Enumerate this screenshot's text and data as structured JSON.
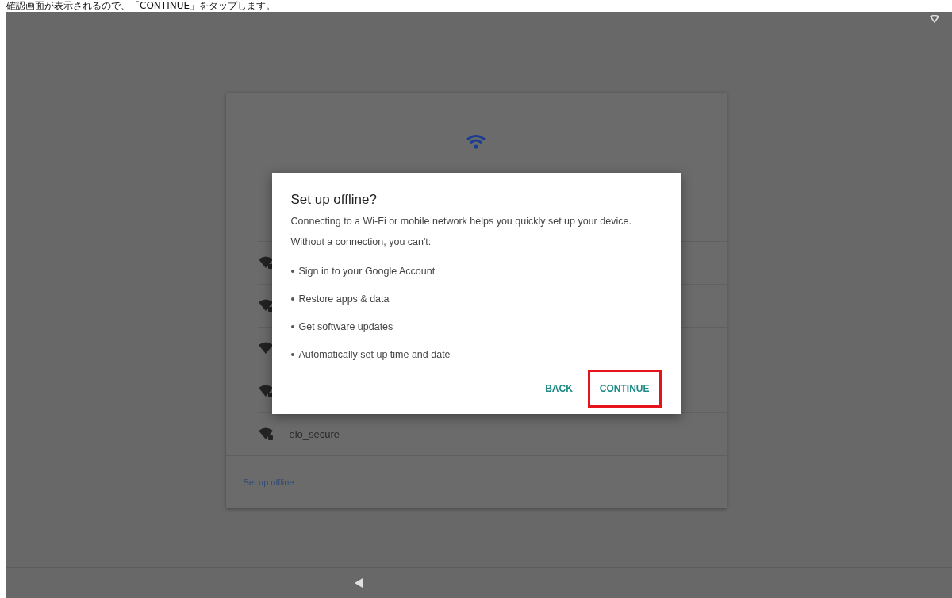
{
  "caption": "確認画面が表示されるので、「CONTINUE」をタップします。",
  "setup": {
    "networks": [
      {
        "locked": true
      },
      {
        "locked": true
      },
      {
        "locked": false
      },
      {
        "locked": true
      },
      {
        "name": "elo_secure",
        "locked": true
      }
    ],
    "offline_link": "Set up offline"
  },
  "dialog": {
    "title": "Set up offline?",
    "message": "Connecting to a Wi-Fi or mobile network helps you quickly set up your device.",
    "list_heading": "Without a connection, you can't:",
    "items": [
      "Sign in to your Google Account",
      "Restore apps & data",
      "Get software updates",
      "Automatically set up time and date"
    ],
    "buttons": [
      {
        "label": "BACK",
        "highlighted": false
      },
      {
        "label": "CONTINUE",
        "highlighted": true
      }
    ]
  }
}
